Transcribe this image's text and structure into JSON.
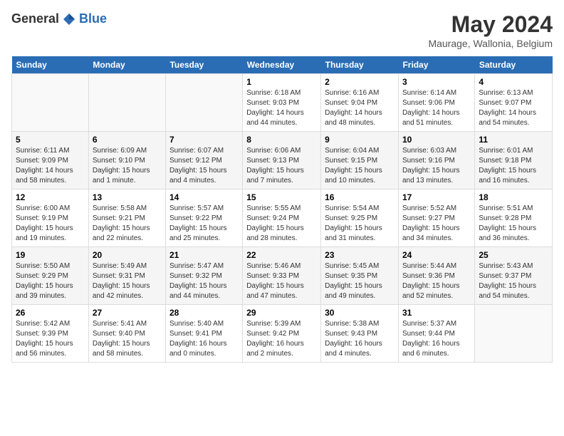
{
  "logo": {
    "general": "General",
    "blue": "Blue"
  },
  "header": {
    "month": "May 2024",
    "location": "Maurage, Wallonia, Belgium"
  },
  "weekdays": [
    "Sunday",
    "Monday",
    "Tuesday",
    "Wednesday",
    "Thursday",
    "Friday",
    "Saturday"
  ],
  "weeks": [
    [
      {
        "day": "",
        "sunrise": "",
        "sunset": "",
        "daylight": ""
      },
      {
        "day": "",
        "sunrise": "",
        "sunset": "",
        "daylight": ""
      },
      {
        "day": "",
        "sunrise": "",
        "sunset": "",
        "daylight": ""
      },
      {
        "day": "1",
        "sunrise": "Sunrise: 6:18 AM",
        "sunset": "Sunset: 9:03 PM",
        "daylight": "Daylight: 14 hours and 44 minutes."
      },
      {
        "day": "2",
        "sunrise": "Sunrise: 6:16 AM",
        "sunset": "Sunset: 9:04 PM",
        "daylight": "Daylight: 14 hours and 48 minutes."
      },
      {
        "day": "3",
        "sunrise": "Sunrise: 6:14 AM",
        "sunset": "Sunset: 9:06 PM",
        "daylight": "Daylight: 14 hours and 51 minutes."
      },
      {
        "day": "4",
        "sunrise": "Sunrise: 6:13 AM",
        "sunset": "Sunset: 9:07 PM",
        "daylight": "Daylight: 14 hours and 54 minutes."
      }
    ],
    [
      {
        "day": "5",
        "sunrise": "Sunrise: 6:11 AM",
        "sunset": "Sunset: 9:09 PM",
        "daylight": "Daylight: 14 hours and 58 minutes."
      },
      {
        "day": "6",
        "sunrise": "Sunrise: 6:09 AM",
        "sunset": "Sunset: 9:10 PM",
        "daylight": "Daylight: 15 hours and 1 minute."
      },
      {
        "day": "7",
        "sunrise": "Sunrise: 6:07 AM",
        "sunset": "Sunset: 9:12 PM",
        "daylight": "Daylight: 15 hours and 4 minutes."
      },
      {
        "day": "8",
        "sunrise": "Sunrise: 6:06 AM",
        "sunset": "Sunset: 9:13 PM",
        "daylight": "Daylight: 15 hours and 7 minutes."
      },
      {
        "day": "9",
        "sunrise": "Sunrise: 6:04 AM",
        "sunset": "Sunset: 9:15 PM",
        "daylight": "Daylight: 15 hours and 10 minutes."
      },
      {
        "day": "10",
        "sunrise": "Sunrise: 6:03 AM",
        "sunset": "Sunset: 9:16 PM",
        "daylight": "Daylight: 15 hours and 13 minutes."
      },
      {
        "day": "11",
        "sunrise": "Sunrise: 6:01 AM",
        "sunset": "Sunset: 9:18 PM",
        "daylight": "Daylight: 15 hours and 16 minutes."
      }
    ],
    [
      {
        "day": "12",
        "sunrise": "Sunrise: 6:00 AM",
        "sunset": "Sunset: 9:19 PM",
        "daylight": "Daylight: 15 hours and 19 minutes."
      },
      {
        "day": "13",
        "sunrise": "Sunrise: 5:58 AM",
        "sunset": "Sunset: 9:21 PM",
        "daylight": "Daylight: 15 hours and 22 minutes."
      },
      {
        "day": "14",
        "sunrise": "Sunrise: 5:57 AM",
        "sunset": "Sunset: 9:22 PM",
        "daylight": "Daylight: 15 hours and 25 minutes."
      },
      {
        "day": "15",
        "sunrise": "Sunrise: 5:55 AM",
        "sunset": "Sunset: 9:24 PM",
        "daylight": "Daylight: 15 hours and 28 minutes."
      },
      {
        "day": "16",
        "sunrise": "Sunrise: 5:54 AM",
        "sunset": "Sunset: 9:25 PM",
        "daylight": "Daylight: 15 hours and 31 minutes."
      },
      {
        "day": "17",
        "sunrise": "Sunrise: 5:52 AM",
        "sunset": "Sunset: 9:27 PM",
        "daylight": "Daylight: 15 hours and 34 minutes."
      },
      {
        "day": "18",
        "sunrise": "Sunrise: 5:51 AM",
        "sunset": "Sunset: 9:28 PM",
        "daylight": "Daylight: 15 hours and 36 minutes."
      }
    ],
    [
      {
        "day": "19",
        "sunrise": "Sunrise: 5:50 AM",
        "sunset": "Sunset: 9:29 PM",
        "daylight": "Daylight: 15 hours and 39 minutes."
      },
      {
        "day": "20",
        "sunrise": "Sunrise: 5:49 AM",
        "sunset": "Sunset: 9:31 PM",
        "daylight": "Daylight: 15 hours and 42 minutes."
      },
      {
        "day": "21",
        "sunrise": "Sunrise: 5:47 AM",
        "sunset": "Sunset: 9:32 PM",
        "daylight": "Daylight: 15 hours and 44 minutes."
      },
      {
        "day": "22",
        "sunrise": "Sunrise: 5:46 AM",
        "sunset": "Sunset: 9:33 PM",
        "daylight": "Daylight: 15 hours and 47 minutes."
      },
      {
        "day": "23",
        "sunrise": "Sunrise: 5:45 AM",
        "sunset": "Sunset: 9:35 PM",
        "daylight": "Daylight: 15 hours and 49 minutes."
      },
      {
        "day": "24",
        "sunrise": "Sunrise: 5:44 AM",
        "sunset": "Sunset: 9:36 PM",
        "daylight": "Daylight: 15 hours and 52 minutes."
      },
      {
        "day": "25",
        "sunrise": "Sunrise: 5:43 AM",
        "sunset": "Sunset: 9:37 PM",
        "daylight": "Daylight: 15 hours and 54 minutes."
      }
    ],
    [
      {
        "day": "26",
        "sunrise": "Sunrise: 5:42 AM",
        "sunset": "Sunset: 9:39 PM",
        "daylight": "Daylight: 15 hours and 56 minutes."
      },
      {
        "day": "27",
        "sunrise": "Sunrise: 5:41 AM",
        "sunset": "Sunset: 9:40 PM",
        "daylight": "Daylight: 15 hours and 58 minutes."
      },
      {
        "day": "28",
        "sunrise": "Sunrise: 5:40 AM",
        "sunset": "Sunset: 9:41 PM",
        "daylight": "Daylight: 16 hours and 0 minutes."
      },
      {
        "day": "29",
        "sunrise": "Sunrise: 5:39 AM",
        "sunset": "Sunset: 9:42 PM",
        "daylight": "Daylight: 16 hours and 2 minutes."
      },
      {
        "day": "30",
        "sunrise": "Sunrise: 5:38 AM",
        "sunset": "Sunset: 9:43 PM",
        "daylight": "Daylight: 16 hours and 4 minutes."
      },
      {
        "day": "31",
        "sunrise": "Sunrise: 5:37 AM",
        "sunset": "Sunset: 9:44 PM",
        "daylight": "Daylight: 16 hours and 6 minutes."
      },
      {
        "day": "",
        "sunrise": "",
        "sunset": "",
        "daylight": ""
      }
    ]
  ]
}
